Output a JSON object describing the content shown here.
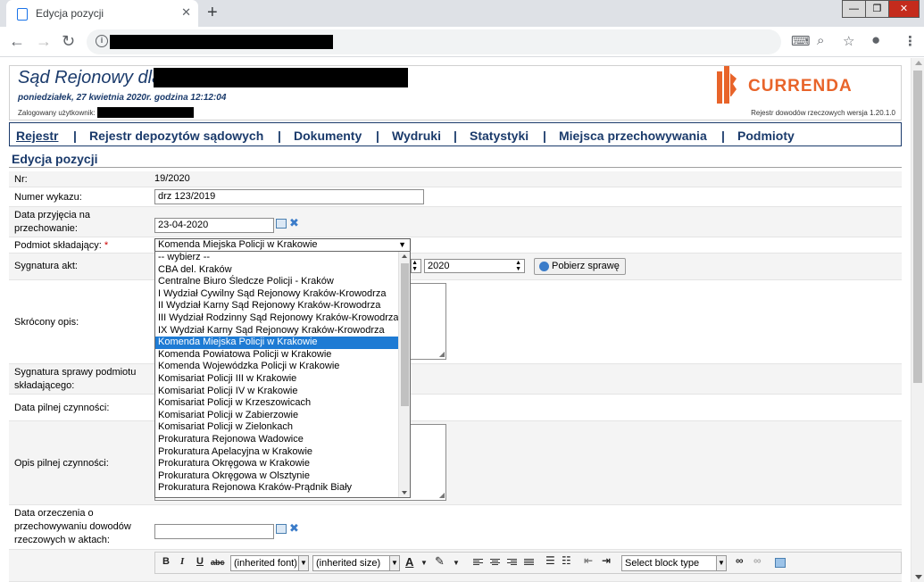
{
  "browser": {
    "tab_title": "Edycja pozycji",
    "tab_close": "✕",
    "new_tab": "+",
    "win_minimize": "—",
    "win_restore": "❐",
    "win_close": "✕"
  },
  "header": {
    "court_title": "Sąd Rejonowy dla",
    "datetime": "poniedziałek, 27 kwietnia 2020r. godzina 12:12:04",
    "logged_user_label": "Zalogowany użytkownik:",
    "version": "Rejestr dowodów rzeczowych wersja 1.20.1.0",
    "logo_text": "CURRENDA"
  },
  "menu": {
    "items": [
      "Rejestr",
      "Rejestr depozytów sądowych",
      "Dokumenty",
      "Wydruki",
      "Statystyki",
      "Miejsca przechowywania",
      "Podmioty"
    ],
    "separator": "|"
  },
  "form": {
    "section_title": "Edycja pozycji",
    "nr_label": "Nr:",
    "nr_value": "19/2020",
    "numer_wykazu_label": "Numer wykazu:",
    "numer_wykazu_value": "drz 123/2019",
    "data_przyjecia_label": "Data przyjęcia na przechowanie:",
    "data_przyjecia_value": "23-04-2020",
    "podmiot_label": "Podmiot składający:",
    "required_mark": "*",
    "podmiot_value": "Komenda Miejska Policji w Krakowie",
    "sygnatura_label": "Sygnatura akt:",
    "sygnatura_year": "2020",
    "pobierz_button": "Pobierz sprawę",
    "skrocony_opis_label": "Skrócony opis:",
    "sygnatura_podmiotu_label": "Sygnatura sprawy podmiotu składającego:",
    "data_pilnej_label": "Data pilnej czynności:",
    "opis_pilnej_label": "Opis pilnej czynności:",
    "data_orzeczenia_label": "Data orzeczenia o przechowywaniu dowodów rzeczowych w aktach:"
  },
  "dropdown": {
    "selected_index": 8,
    "options": [
      "-- wybierz --",
      "CBA del. Kraków",
      "Centralne Biuro Śledcze Policji - Kraków",
      "I Wydział Cywilny Sąd Rejonowy Kraków-Krowodrza",
      "II Wydział Karny Sąd Rejonowy Kraków-Krowodrza",
      "III Wydział Rodzinny Sąd Rejonowy Kraków-Krowodrza",
      "IX Wydział Karny Sąd Rejonowy Kraków-Krowodrza",
      "Komenda Miejska Policji w Krakowie",
      "Komenda Miejska Policji w Krakowie",
      "Komenda Powiatowa Policji w Krakowie",
      "Komenda Wojewódzka Policji w Krakowie",
      "Komisariat Policji III w Krakowie",
      "Komisariat Policji IV w Krakowie",
      "Komisariat Policji w Krzeszowicach",
      "Komisariat Policji w Zabierzowie",
      "Komisariat Policji w Zielonkach",
      "Prokuratura Rejonowa Wadowice",
      "Prokuratura Apelacyjna w Krakowie",
      "Prokuratura Okręgowa w Krakowie",
      "Prokuratura Okręgowa w Olsztynie",
      "Prokuratura Rejonowa Kraków-Prądnik Biały"
    ]
  },
  "editor": {
    "bold": "B",
    "italic": "I",
    "underline": "U",
    "strike": "abc",
    "font_family": "(inherited font)",
    "font_size": "(inherited size)",
    "font_color": "A",
    "block_type": "Select block type"
  },
  "colors": {
    "brand_navy": "#1a3a6b",
    "currenda_orange": "#e8642a",
    "selection_blue": "#1e7bd4"
  }
}
